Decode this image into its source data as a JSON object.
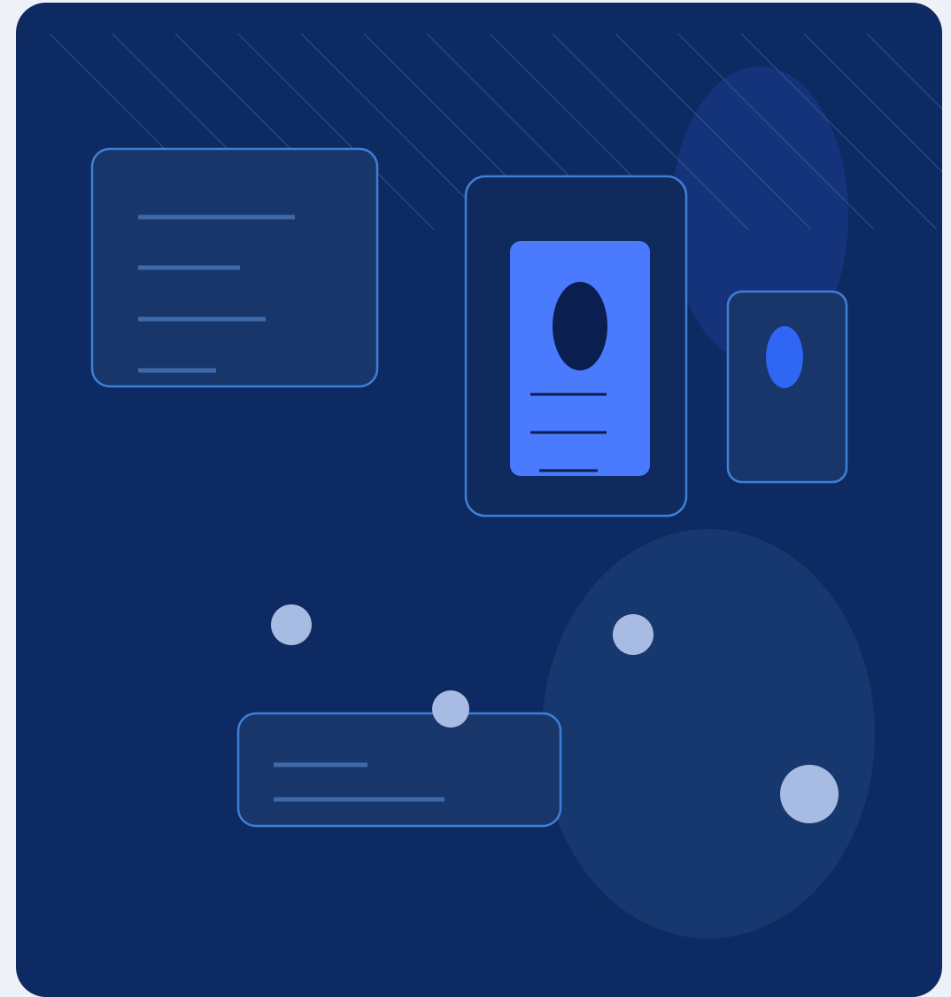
{
  "illustration": {
    "subject": "abstract-devices-scene",
    "palette": {
      "page_background": "#eef1f8",
      "panel_background": "#0e2a62",
      "card_fill": "#18366a",
      "card_stroke": "#3f7fd6",
      "device_fill": "#0f2a5c",
      "screen_fill": "#4a7bff",
      "accent_blue": "#2f66f4",
      "avatar_dark": "#0a1e4f",
      "text_line": "#3e6aa9",
      "dot_fill": "#a8bbe2",
      "blob_fill": "#17386f",
      "glow_fill": "#15337a",
      "hatch_stroke": "#4c6fb0"
    },
    "icons": [
      "document-card-icon",
      "phone-icon",
      "profile-screen-icon",
      "small-phone-icon",
      "message-card-icon",
      "dot-icon"
    ]
  }
}
